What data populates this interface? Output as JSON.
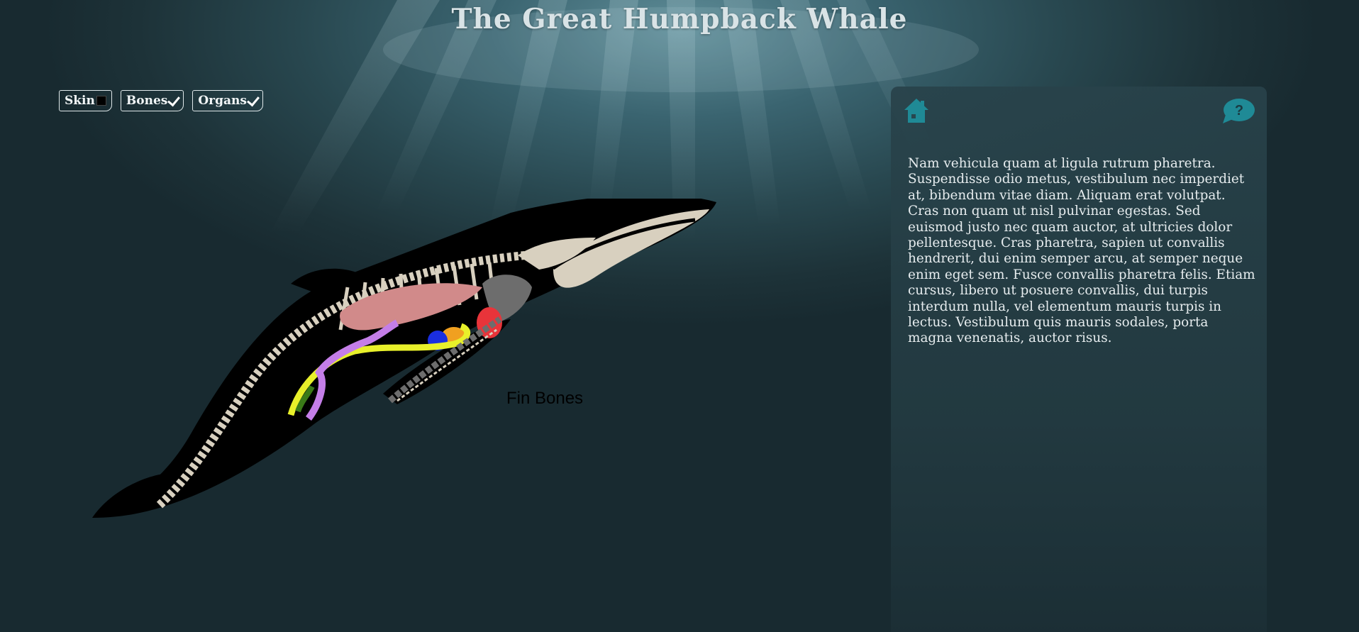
{
  "page": {
    "title": "The Great Humpback Whale"
  },
  "toggles": [
    {
      "label": "Skin",
      "checked": false
    },
    {
      "label": "Bones",
      "checked": true
    },
    {
      "label": "Organs",
      "checked": true
    }
  ],
  "whale": {
    "hover_label": "Fin Bones"
  },
  "panel": {
    "home_icon": "home-icon",
    "help_icon": "help-icon",
    "help_glyph": "?",
    "description": "Nam vehicula quam at ligula rutrum pharetra. Suspendisse odio metus, vestibulum nec imperdiet at, bibendum vitae diam. Aliquam erat volutpat. Cras non quam ut nisl pulvinar egestas. Sed euismod justo nec quam auctor, at ultricies dolor pellentesque. Cras pharetra, sapien ut convallis hendrerit, dui enim semper arcu, at semper neque enim eget sem. Fusce convallis pharetra felis. Etiam cursus, libero ut posuere convallis, dui turpis interdum nulla, vel elementum mauris turpis in lectus. Vestibulum quis mauris sodales, porta magna venenatis, auctor risus."
  },
  "colors": {
    "accent": "#1f8a96",
    "bone": "#d8d0bf",
    "whale_body": "#000000",
    "lungs": "#d18a8a",
    "heart": "#e8343a",
    "stomach": "#f0a020",
    "kidney": "#1a2ee0",
    "intestine": "#e8f02a",
    "intestine_purple": "#c47ee8",
    "liver_grey": "#6d6d6d",
    "green_organ": "#3a7a18"
  }
}
